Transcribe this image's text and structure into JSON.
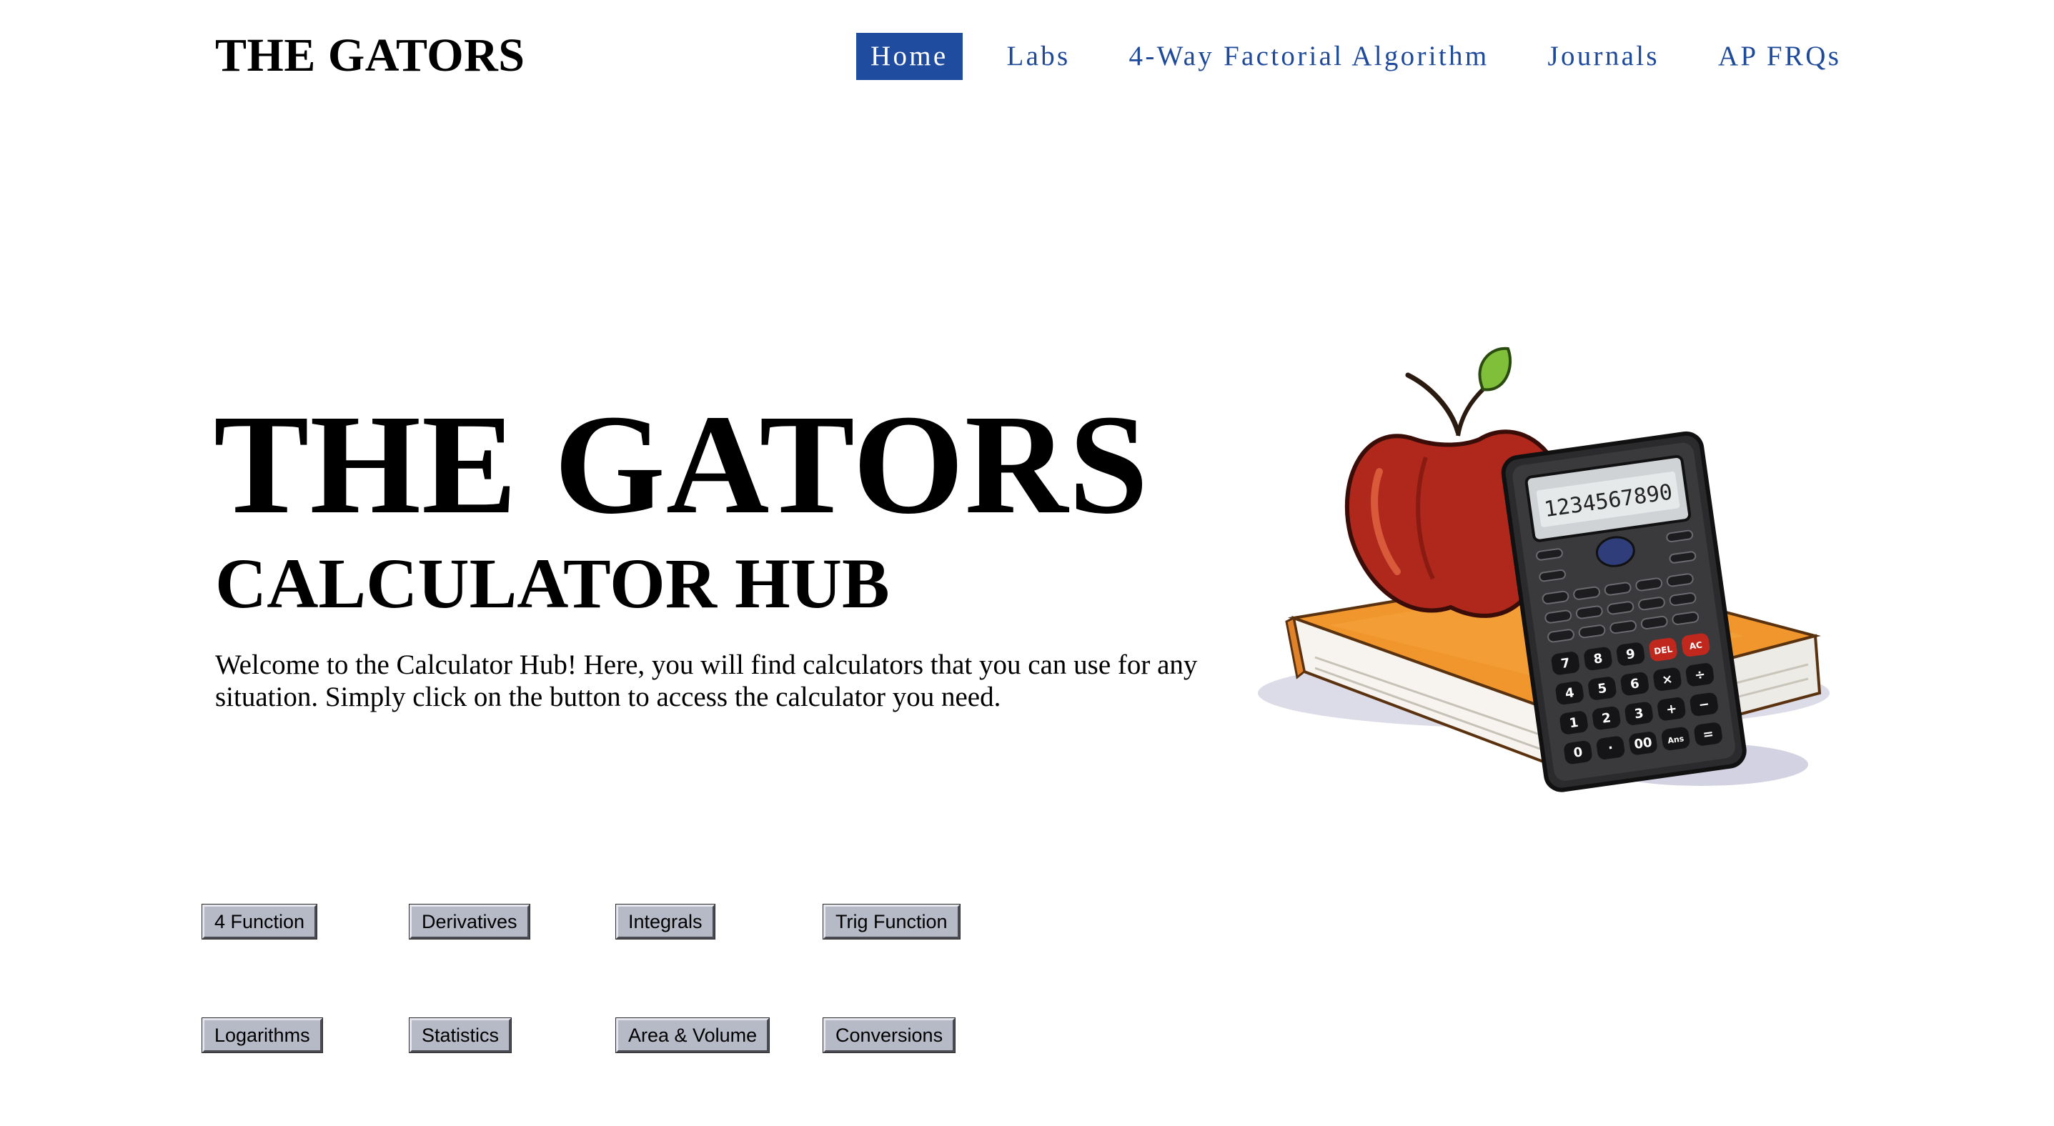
{
  "header": {
    "brand": "THE GATORS",
    "nav": [
      {
        "label": "Home",
        "active": true
      },
      {
        "label": "Labs",
        "active": false
      },
      {
        "label": "4-Way Factorial Algorithm",
        "active": false
      },
      {
        "label": "Journals",
        "active": false
      },
      {
        "label": "AP FRQs",
        "active": false
      }
    ]
  },
  "hero": {
    "title": "THE GATORS",
    "subtitle": "CALCULATOR HUB",
    "text": "Welcome to the Calculator Hub! Here, you will find calculators that you can use for any situation. Simply click on the button to access the calculator you need.",
    "image_icon": "apple-book-calculator-illustration",
    "calculator_display": "1234567890"
  },
  "buttons": {
    "row1": [
      "4 Function",
      "Derivatives",
      "Integrals",
      "Trig Function"
    ],
    "row2": [
      "Logarithms",
      "Statistics",
      "Area & Volume",
      "Conversions"
    ]
  },
  "colors": {
    "nav_text": "#1f4a9a",
    "nav_active_bg": "#1f4c9e",
    "button_bg": "#b6b9c6"
  }
}
